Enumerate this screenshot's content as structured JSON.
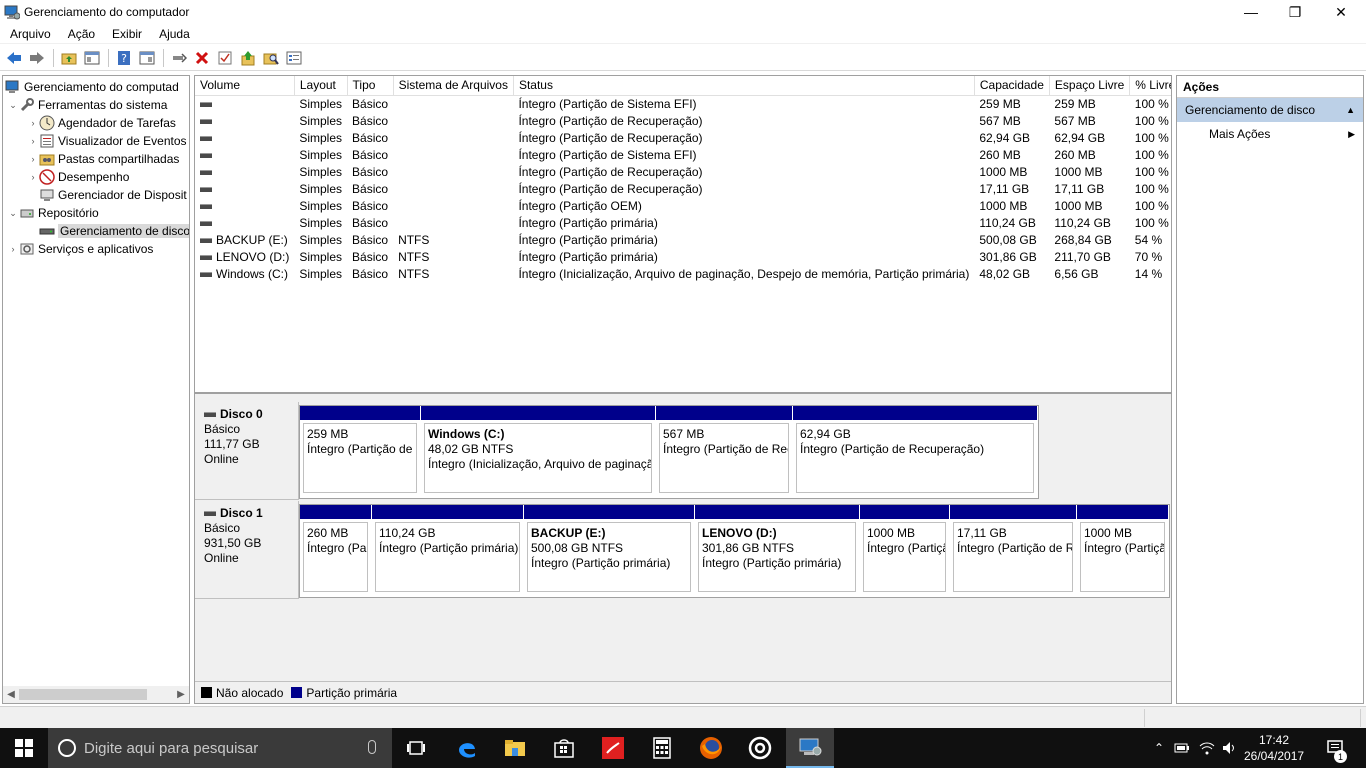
{
  "window": {
    "title": "Gerenciamento do computador",
    "minimize": "—",
    "maximize": "❐",
    "close": "✕"
  },
  "menu": [
    "Arquivo",
    "Ação",
    "Exibir",
    "Ajuda"
  ],
  "tree": [
    {
      "label": "Gerenciamento do computad",
      "icon": "computer-management-icon",
      "arrow": "",
      "indent": 0
    },
    {
      "label": "Ferramentas do sistema",
      "icon": "system-tools-icon",
      "arrow": "⌄",
      "indent": 1
    },
    {
      "label": "Agendador de Tarefas",
      "icon": "clock-icon",
      "arrow": "›",
      "indent": 2
    },
    {
      "label": "Visualizador de Eventos",
      "icon": "event-viewer-icon",
      "arrow": "›",
      "indent": 2
    },
    {
      "label": "Pastas compartilhadas",
      "icon": "shared-folders-icon",
      "arrow": "›",
      "indent": 2
    },
    {
      "label": "Desempenho",
      "icon": "performance-icon",
      "arrow": "›",
      "indent": 2
    },
    {
      "label": "Gerenciador de Disposit",
      "icon": "device-manager-icon",
      "arrow": "",
      "indent": 2
    },
    {
      "label": "Repositório",
      "icon": "storage-icon",
      "arrow": "⌄",
      "indent": 1
    },
    {
      "label": "Gerenciamento de disco",
      "icon": "disk-management-icon",
      "arrow": "",
      "indent": 2,
      "selected": true
    },
    {
      "label": "Serviços e aplicativos",
      "icon": "services-icon",
      "arrow": "›",
      "indent": 1
    }
  ],
  "volumes": {
    "headers": [
      "Volume",
      "Layout",
      "Tipo",
      "Sistema de Arquivos",
      "Status",
      "Capacidade",
      "Espaço Livre",
      "% Livre"
    ],
    "rows": [
      [
        "",
        "Simples",
        "Básico",
        "",
        "Íntegro (Partição de Sistema EFI)",
        "259 MB",
        "259 MB",
        "100 %"
      ],
      [
        "",
        "Simples",
        "Básico",
        "",
        "Íntegro (Partição de Recuperação)",
        "567 MB",
        "567 MB",
        "100 %"
      ],
      [
        "",
        "Simples",
        "Básico",
        "",
        "Íntegro (Partição de Recuperação)",
        "62,94 GB",
        "62,94 GB",
        "100 %"
      ],
      [
        "",
        "Simples",
        "Básico",
        "",
        "Íntegro (Partição de Sistema EFI)",
        "260 MB",
        "260 MB",
        "100 %"
      ],
      [
        "",
        "Simples",
        "Básico",
        "",
        "Íntegro (Partição de Recuperação)",
        "1000 MB",
        "1000 MB",
        "100 %"
      ],
      [
        "",
        "Simples",
        "Básico",
        "",
        "Íntegro (Partição de Recuperação)",
        "17,11 GB",
        "17,11 GB",
        "100 %"
      ],
      [
        "",
        "Simples",
        "Básico",
        "",
        "Íntegro (Partição OEM)",
        "1000 MB",
        "1000 MB",
        "100 %"
      ],
      [
        "",
        "Simples",
        "Básico",
        "",
        "Íntegro (Partição primária)",
        "110,24 GB",
        "110,24 GB",
        "100 %"
      ],
      [
        "BACKUP (E:)",
        "Simples",
        "Básico",
        "NTFS",
        "Íntegro (Partição primária)",
        "500,08 GB",
        "268,84 GB",
        "54 %"
      ],
      [
        "LENOVO (D:)",
        "Simples",
        "Básico",
        "NTFS",
        "Íntegro (Partição primária)",
        "301,86 GB",
        "211,70 GB",
        "70 %"
      ],
      [
        "Windows (C:)",
        "Simples",
        "Básico",
        "NTFS",
        "Íntegro (Inicialização, Arquivo de paginação, Despejo de memória, Partição primária)",
        "48,02 GB",
        "6,56 GB",
        "14 %"
      ]
    ]
  },
  "disks": [
    {
      "name": "Disco 0",
      "type": "Básico",
      "size": "111,77 GB",
      "state": "Online",
      "partitions": [
        {
          "name": "",
          "size": "259 MB",
          "status": "Íntegro (Partição de Sistema EFI)"
        },
        {
          "name": "Windows  (C:)",
          "size": "48,02 GB NTFS",
          "status": "Íntegro (Inicialização, Arquivo de paginação)"
        },
        {
          "name": "",
          "size": "567 MB",
          "status": "Íntegro (Partição de Recuperação)"
        },
        {
          "name": "",
          "size": "62,94 GB",
          "status": "Íntegro (Partição de Recuperação)"
        }
      ]
    },
    {
      "name": "Disco 1",
      "type": "Básico",
      "size": "931,50 GB",
      "state": "Online",
      "partitions": [
        {
          "name": "",
          "size": "260 MB",
          "status": "Íntegro (Partição de Sistema EFI)"
        },
        {
          "name": "",
          "size": "110,24 GB",
          "status": "Íntegro (Partição primária)"
        },
        {
          "name": "BACKUP  (E:)",
          "size": "500,08 GB NTFS",
          "status": "Íntegro (Partição primária)"
        },
        {
          "name": "LENOVO  (D:)",
          "size": "301,86 GB NTFS",
          "status": "Íntegro (Partição primária)"
        },
        {
          "name": "",
          "size": "1000 MB",
          "status": "Íntegro (Partição OEM)"
        },
        {
          "name": "",
          "size": "17,11 GB",
          "status": "Íntegro (Partição de Recuperação)"
        },
        {
          "name": "",
          "size": "1000 MB",
          "status": "Íntegro (Partição de Recuperação)"
        }
      ]
    }
  ],
  "legend": [
    {
      "label": "Não alocado",
      "color": "#000000"
    },
    {
      "label": "Partição primária",
      "color": "#00008b"
    }
  ],
  "actions": {
    "title": "Ações",
    "section": "Gerenciamento de disco",
    "more": "Mais Ações"
  },
  "taskbar": {
    "search_placeholder": "Digite aqui para pesquisar",
    "time": "17:42",
    "date": "26/04/2017",
    "notification_count": "1"
  }
}
